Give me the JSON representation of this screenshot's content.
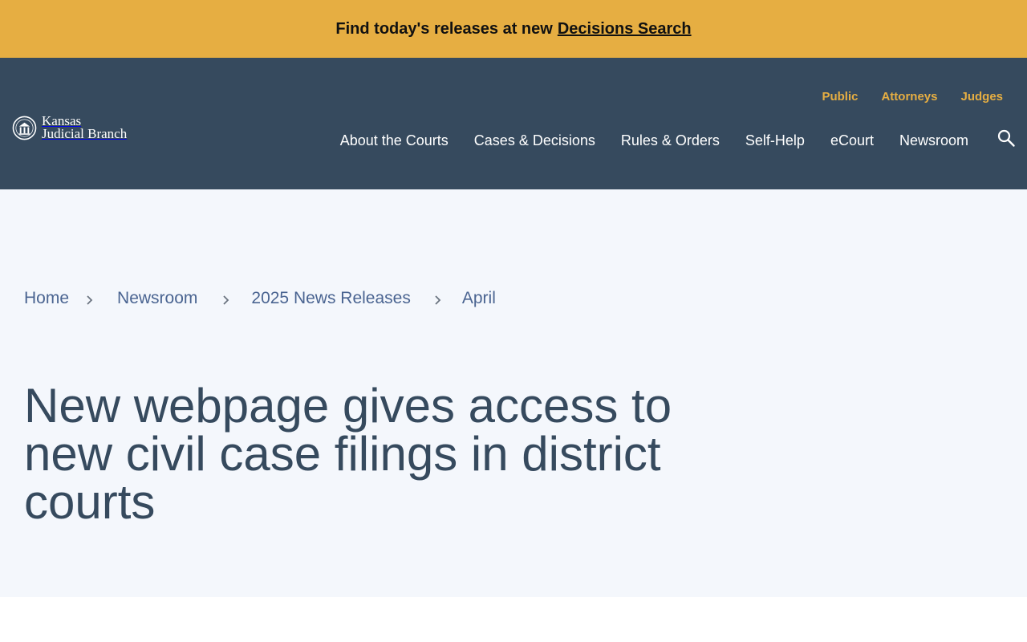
{
  "alert": {
    "text": "Find today's releases at new",
    "link_label": "Decisions Search"
  },
  "header": {
    "logo": {
      "line1": "Kansas",
      "line2": "Judicial Branch",
      "icon": "seal-icon"
    },
    "audience_nav": [
      "Public",
      "Attorneys",
      "Judges"
    ],
    "main_nav": [
      "About the Courts",
      "Cases & Decisions",
      "Rules & Orders",
      "Self-Help",
      "eCourt",
      "Newsroom"
    ],
    "search_icon": "search-icon"
  },
  "breadcrumb": [
    "Home",
    "Newsroom",
    "2025 News Releases",
    "April"
  ],
  "page": {
    "title": "New webpage gives access to new civil case filings in district courts"
  },
  "colors": {
    "alert_bg": "#E6AE42",
    "header_bg": "#364A5E",
    "accent": "#E6AE42",
    "hero_bg": "#F4F7FC",
    "link": "#4A6491",
    "title": "#364A5E"
  }
}
